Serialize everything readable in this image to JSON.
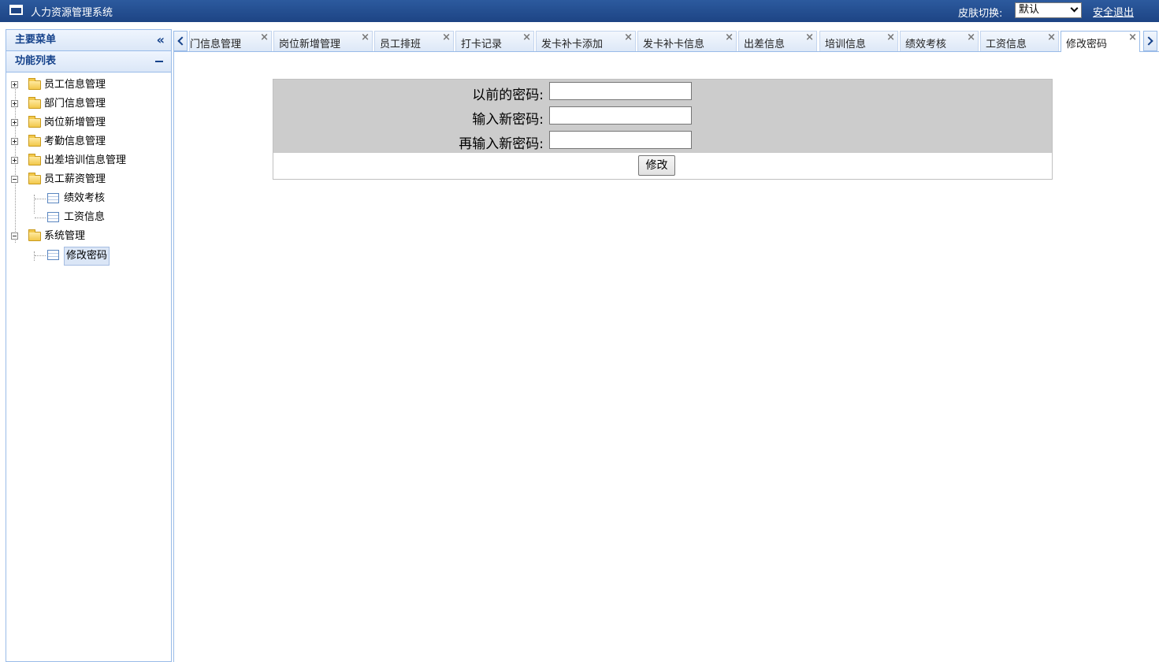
{
  "header": {
    "title": "人力资源管理系统",
    "skin_label": "皮肤切换:",
    "skin_value": "默认",
    "logout": "安全退出"
  },
  "sidebar": {
    "main_menu": "主要菜单",
    "function_list": "功能列表",
    "tree": [
      {
        "label": "员工信息管理",
        "expanded": false
      },
      {
        "label": "部门信息管理",
        "expanded": false
      },
      {
        "label": "岗位新增管理",
        "expanded": false
      },
      {
        "label": "考勤信息管理",
        "expanded": false
      },
      {
        "label": "出差培训信息管理",
        "expanded": false
      },
      {
        "label": "员工薪资管理",
        "expanded": true,
        "children": [
          "绩效考核",
          "工资信息"
        ]
      },
      {
        "label": "系统管理",
        "expanded": true,
        "children": [
          "修改密码"
        ]
      }
    ]
  },
  "tabs": [
    "门信息管理",
    "岗位新增管理",
    "员工排班",
    "打卡记录",
    "发卡补卡添加",
    "发卡补卡信息",
    "出差信息",
    "培训信息",
    "绩效考核",
    "工资信息",
    "修改密码"
  ],
  "active_tab": "修改密码",
  "form": {
    "old_password_label": "以前的密码:",
    "new_password_label": "输入新密码:",
    "confirm_password_label": "再输入新密码:",
    "submit_label": "修改"
  }
}
